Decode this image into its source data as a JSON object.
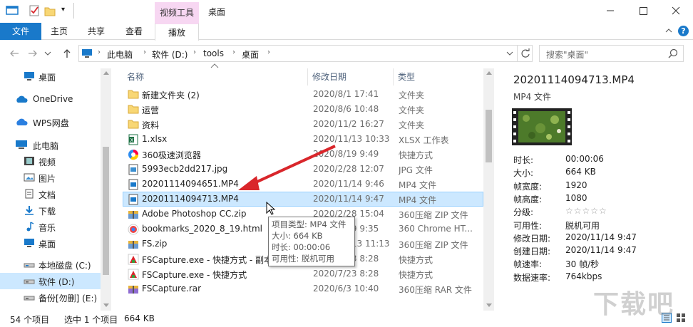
{
  "titlebar": {
    "context_group": "视频工具",
    "title": "桌面",
    "qat_dropdown": "▾"
  },
  "ribbon": {
    "file_tab": "文件",
    "tabs": [
      "主页",
      "共享",
      "查看"
    ],
    "context_tab": "播放"
  },
  "address": {
    "crumbs": [
      "此电脑",
      "软件 (D:)",
      "tools",
      "桌面"
    ],
    "search_placeholder": "搜索\"桌面\""
  },
  "nav": {
    "items": [
      {
        "label": "桌面",
        "icon": "desktop-icon"
      },
      {
        "label": "OneDrive",
        "icon": "cloud-icon"
      },
      {
        "label": "WPS网盘",
        "icon": "cloud-icon"
      },
      {
        "label": "此电脑",
        "icon": "computer-icon"
      },
      {
        "label": "视频",
        "icon": "video-folder-icon"
      },
      {
        "label": "图片",
        "icon": "pictures-folder-icon"
      },
      {
        "label": "文档",
        "icon": "documents-folder-icon"
      },
      {
        "label": "下载",
        "icon": "download-icon"
      },
      {
        "label": "音乐",
        "icon": "music-icon"
      },
      {
        "label": "桌面",
        "icon": "desktop-icon"
      },
      {
        "label": "本地磁盘 (C:)",
        "icon": "drive-icon"
      },
      {
        "label": "软件 (D:)",
        "icon": "drive-icon"
      },
      {
        "label": "备份[勿删] (E:)",
        "icon": "drive-icon"
      }
    ],
    "selected_index": 11
  },
  "columns": {
    "name": "名称",
    "date": "修改日期",
    "type": "类型"
  },
  "files": [
    {
      "name": "新建文件夹 (2)",
      "date": "2020/8/1 17:41",
      "type": "文件夹",
      "icon": "folder-icon"
    },
    {
      "name": "运营",
      "date": "2020/8/6 10:48",
      "type": "文件夹",
      "icon": "folder-icon"
    },
    {
      "name": "资料",
      "date": "2020/11/2 16:27",
      "type": "文件夹",
      "icon": "folder-icon"
    },
    {
      "name": "1.xlsx",
      "date": "2020/11/13 10:33",
      "type": "XLSX 工作表",
      "icon": "excel-icon"
    },
    {
      "name": "360极速浏览器",
      "date": "2020/8/19 9:49",
      "type": "快捷方式",
      "icon": "browser-icon"
    },
    {
      "name": "5993ecb2dd217.jpg",
      "date": "2020/2/28 12:07",
      "type": "JPG 文件",
      "icon": "image-file-icon"
    },
    {
      "name": "20201114094651.MP4",
      "date": "2020/11/14 9:46",
      "type": "MP4 文件",
      "icon": "video-file-icon"
    },
    {
      "name": "20201114094713.MP4",
      "date": "2020/11/14 9:47",
      "type": "MP4 文件",
      "icon": "video-file-icon"
    },
    {
      "name": "Adobe Photoshop CC.zip",
      "date": "2020/2/28 15:04",
      "type": "360压缩 ZIP 文件",
      "icon": "zip-icon"
    },
    {
      "name": "bookmarks_2020_8_19.html",
      "date": "2020/8/19 9:35",
      "type": "360 Chrome HT...",
      "icon": "html-icon"
    },
    {
      "name": "FS.zip",
      "date": "2020/11/13 11:13",
      "type": "360压缩 ZIP 文件",
      "icon": "zip-icon"
    },
    {
      "name": "FSCapture.exe - 快捷方式 - 副本",
      "date": "2020/7/23 8:28",
      "type": "快捷方式",
      "icon": "fscapture-icon"
    },
    {
      "name": "FSCapture.exe - 快捷方式",
      "date": "2020/7/23 8:28",
      "type": "快捷方式",
      "icon": "fscapture-icon"
    },
    {
      "name": "FSCapture.rar",
      "date": "2020/6/3 10:40",
      "type": "360压缩 RAR 文件",
      "icon": "rar-icon"
    }
  ],
  "selected_file_index": 7,
  "tooltip": {
    "lines": [
      "项目类型: MP4 文件",
      "大小: 664 KB",
      "时长: 00:00:06",
      "可用性: 脱机可用"
    ]
  },
  "details": {
    "filename": "20201114094713.MP4",
    "filetype": "MP4 文件",
    "props": [
      {
        "label": "时长:",
        "value": "00:00:06"
      },
      {
        "label": "大小:",
        "value": "664 KB"
      },
      {
        "label": "帧宽度:",
        "value": "1920"
      },
      {
        "label": "帧高度:",
        "value": "1080"
      },
      {
        "label": "分级:",
        "value": "☆☆☆☆☆"
      },
      {
        "label": "可用性:",
        "value": "脱机可用"
      },
      {
        "label": "修改日期:",
        "value": "2020/11/14 9:47"
      },
      {
        "label": "创建日期:",
        "value": "2020/11/14 9:47"
      },
      {
        "label": "帧速率:",
        "value": "30 帧/秒"
      },
      {
        "label": "数据速率:",
        "value": "764kbps"
      }
    ],
    "rating_stars": 0
  },
  "status": {
    "count": "54 个项目",
    "selection": "选中 1 个项目",
    "size": "664 KB"
  },
  "watermark": "下载吧",
  "colors": {
    "accent": "#1979ca",
    "selection": "#cce8ff",
    "context_tab": "#f7d7f2",
    "arrow": "#d9262b"
  }
}
